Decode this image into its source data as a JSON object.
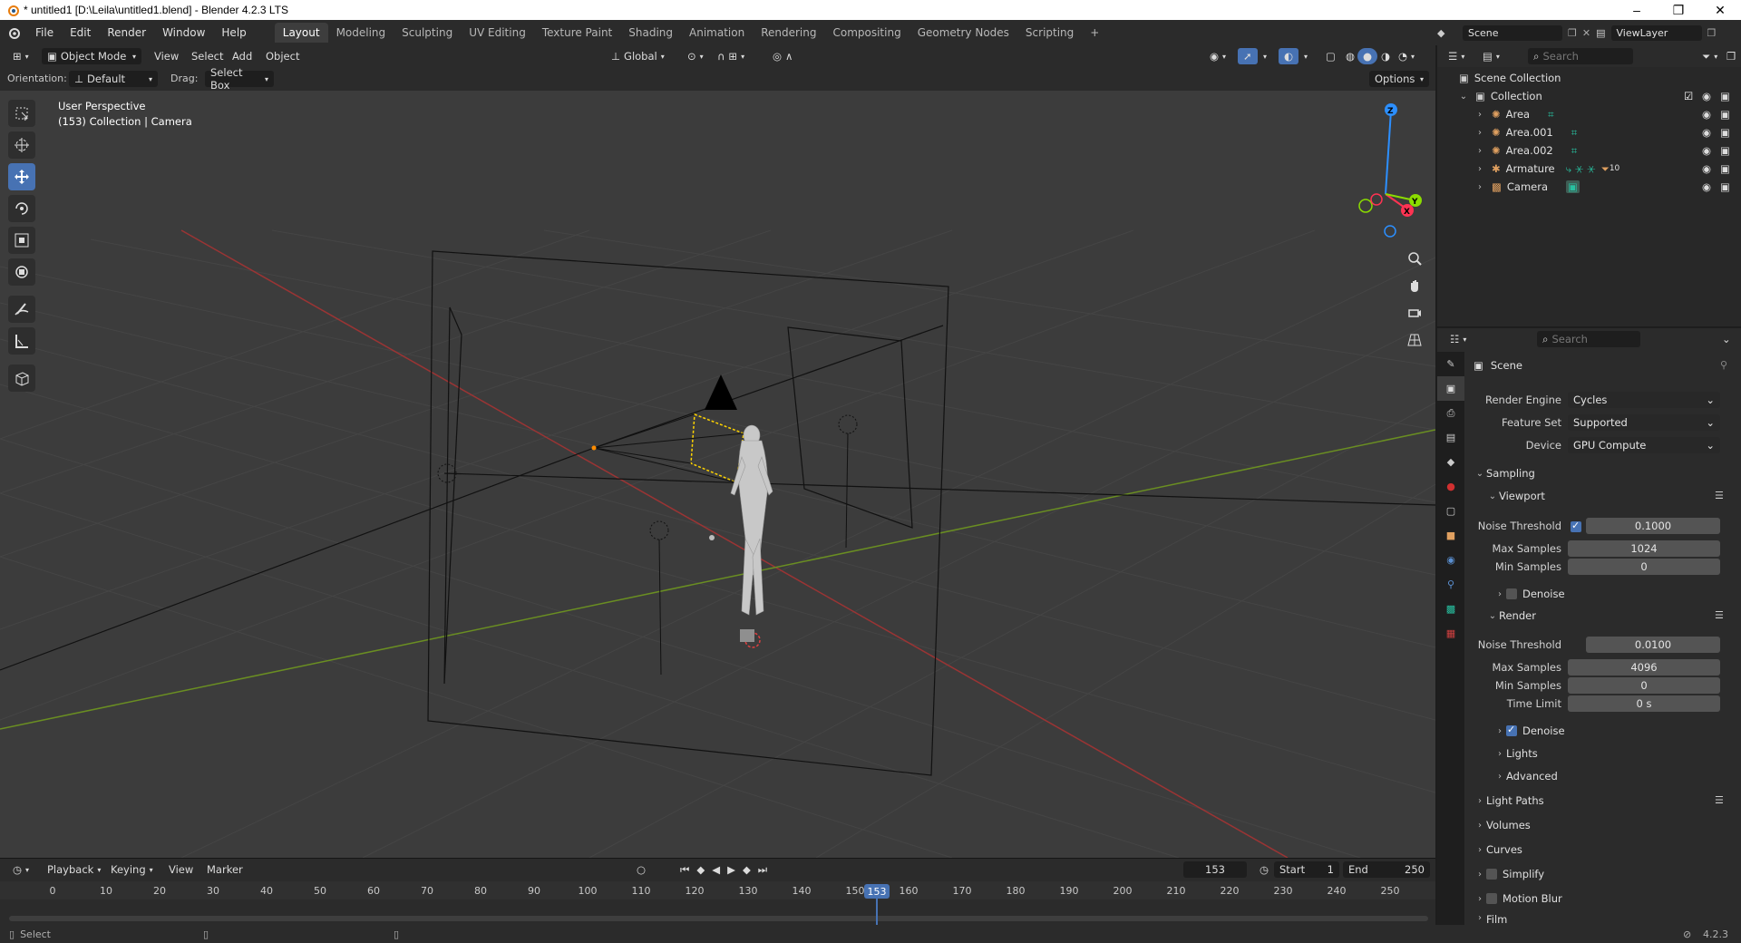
{
  "title_bar": {
    "title": "* untitled1 [D:\\Leila\\untitled1.blend] - Blender 4.2.3 LTS",
    "min": "–",
    "max": "❐",
    "close": "✕"
  },
  "menu": [
    "File",
    "Edit",
    "Render",
    "Window",
    "Help"
  ],
  "workspaces": [
    "Layout",
    "Modeling",
    "Sculpting",
    "UV Editing",
    "Texture Paint",
    "Shading",
    "Animation",
    "Rendering",
    "Compositing",
    "Geometry Nodes",
    "Scripting"
  ],
  "active_workspace": "Layout",
  "add_workspace": "+",
  "scene_selector": {
    "scene": "Scene",
    "view_layer": "ViewLayer"
  },
  "viewport_header": {
    "mode": "Object Mode",
    "menus": [
      "View",
      "Select",
      "Add",
      "Object"
    ],
    "transform_orientation": "Global",
    "orientation_label": "Orientation:",
    "orientation_value": "Default",
    "drag_label": "Drag:",
    "drag_value": "Select Box",
    "options": "Options"
  },
  "viewport": {
    "perspective": "User Perspective",
    "collection_info": "(153) Collection | Camera",
    "gizmo": {
      "x": "X",
      "y": "Y",
      "z": "Z"
    }
  },
  "tools": [
    "select-box-icon",
    "cursor-icon",
    "move-icon",
    "rotate-icon",
    "scale-icon",
    "transform-icon",
    "annotate-icon",
    "measure-icon",
    "add-cube-icon"
  ],
  "active_tool": "move-icon",
  "timeline": {
    "menus": [
      "Playback",
      "Keying",
      "View",
      "Marker"
    ],
    "current_frame": "153",
    "start_label": "Start",
    "start": "1",
    "end_label": "End",
    "end": "250",
    "ruler": [
      "0",
      "10",
      "20",
      "30",
      "40",
      "50",
      "60",
      "70",
      "80",
      "90",
      "100",
      "110",
      "120",
      "130",
      "140",
      "150",
      "160",
      "170",
      "180",
      "190",
      "200",
      "210",
      "220",
      "230",
      "240",
      "250"
    ],
    "playhead_label": "153"
  },
  "status_bar": {
    "left": "Select",
    "version": "4.2.3"
  },
  "outliner": {
    "search_placeholder": "Search",
    "root": "Scene Collection",
    "collection": "Collection",
    "items": [
      {
        "name": "Area",
        "icon": "light-icon"
      },
      {
        "name": "Area.001",
        "icon": "light-icon"
      },
      {
        "name": "Area.002",
        "icon": "light-icon"
      },
      {
        "name": "Armature",
        "icon": "armature-icon",
        "extra_count": "10"
      },
      {
        "name": "Camera",
        "icon": "camera-icon"
      }
    ]
  },
  "properties": {
    "search_placeholder": "Search",
    "context": "Scene",
    "render_engine_label": "Render Engine",
    "render_engine": "Cycles",
    "feature_set_label": "Feature Set",
    "feature_set": "Supported",
    "device_label": "Device",
    "device": "GPU Compute",
    "sampling": "Sampling",
    "viewport": "Viewport",
    "vp_noise_label": "Noise Threshold",
    "vp_noise": "0.1000",
    "vp_max_label": "Max Samples",
    "vp_max": "1024",
    "vp_min_label": "Min Samples",
    "vp_min": "0",
    "denoise": "Denoise",
    "render": "Render",
    "r_noise_label": "Noise Threshold",
    "r_noise": "0.0100",
    "r_max_label": "Max Samples",
    "r_max": "4096",
    "r_min_label": "Min Samples",
    "r_min": "0",
    "r_time_label": "Time Limit",
    "r_time": "0 s",
    "r_denoise": "Denoise",
    "lights": "Lights",
    "advanced": "Advanced",
    "light_paths": "Light Paths",
    "volumes": "Volumes",
    "curves": "Curves",
    "simplify": "Simplify",
    "motion_blur": "Motion Blur",
    "film": "Film"
  },
  "colors": {
    "accent": "#4772b3",
    "x_axis": "#9b3434",
    "y_axis": "#6a8e22",
    "viewport_bg": "#3c3c3c"
  }
}
